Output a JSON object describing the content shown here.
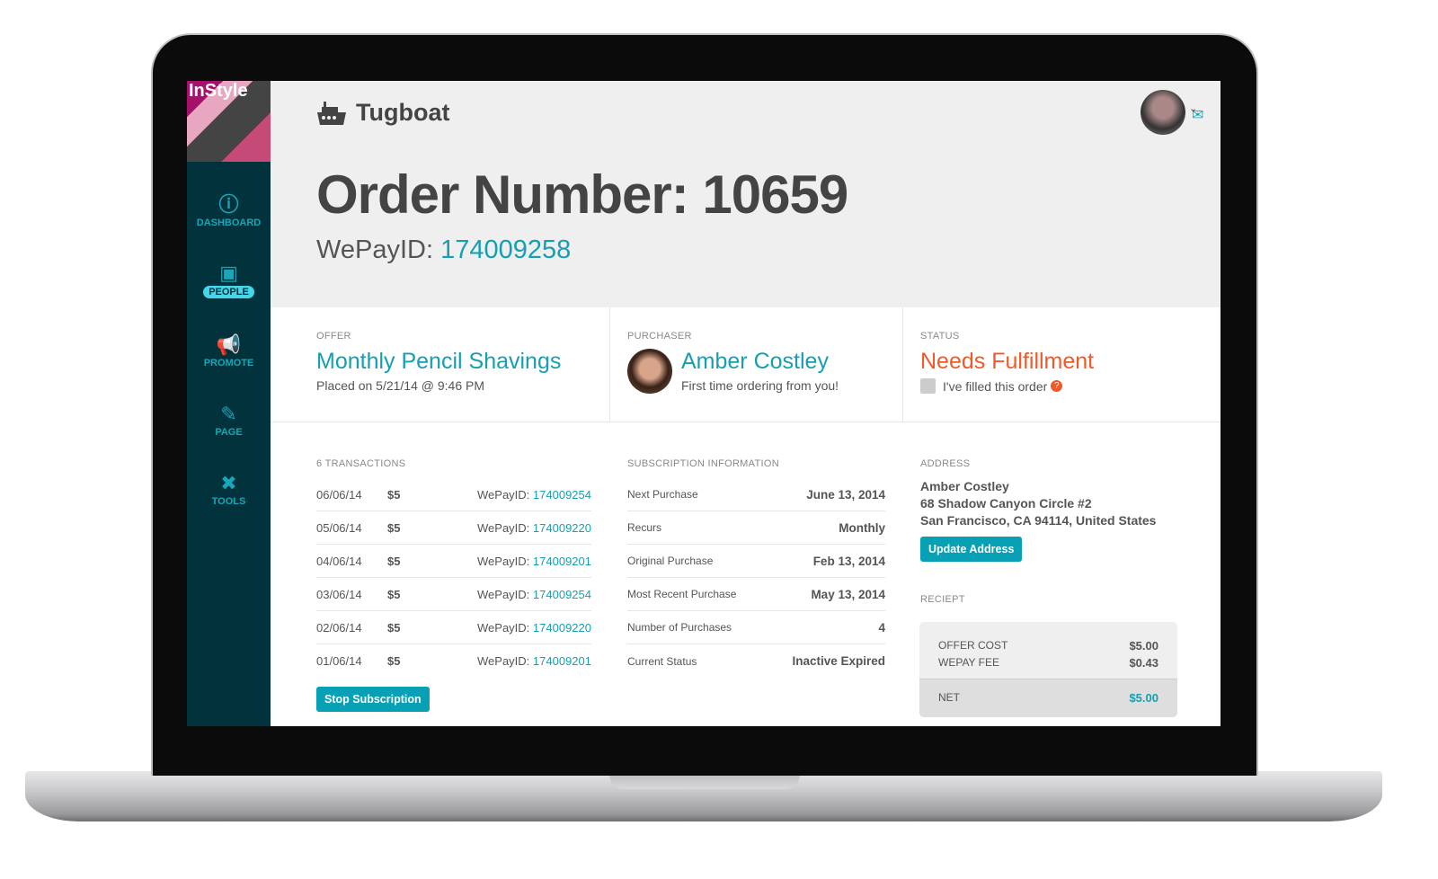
{
  "sidebar": {
    "brand_image_text": "InStyle",
    "items": [
      {
        "label": "DASHBOARD",
        "icon": "gauge-icon"
      },
      {
        "label": "PEOPLE",
        "icon": "address-book-icon",
        "active": true
      },
      {
        "label": "PROMOTE",
        "icon": "megaphone-icon"
      },
      {
        "label": "PAGE",
        "icon": "pencil-icon"
      },
      {
        "label": "TOOLS",
        "icon": "tools-icon"
      }
    ]
  },
  "header": {
    "app_name": "Tugboat",
    "title": "Order Number: 10659",
    "wepay_label": "WePayID:",
    "wepay_id": "174009258"
  },
  "offer": {
    "label": "OFFER",
    "name": "Monthly Pencil Shavings",
    "placed": "Placed on 5/21/14 @ 9:46 PM"
  },
  "purchaser": {
    "label": "PURCHASER",
    "name": "Amber Costley",
    "note": "First time ordering from you!"
  },
  "status": {
    "label": "STATUS",
    "value": "Needs Fulfillment",
    "checkbox_label": "I've filled this order",
    "checked": false,
    "color": "#f05a28"
  },
  "transactions": {
    "label": "6 TRANSACTIONS",
    "rows": [
      {
        "date": "06/06/14",
        "amount": "$5",
        "id_label": "WePayID:",
        "id": "174009254"
      },
      {
        "date": "05/06/14",
        "amount": "$5",
        "id_label": "WePayID:",
        "id": "174009220"
      },
      {
        "date": "04/06/14",
        "amount": "$5",
        "id_label": "WePayID:",
        "id": "174009201"
      },
      {
        "date": "03/06/14",
        "amount": "$5",
        "id_label": "WePayID:",
        "id": "174009254"
      },
      {
        "date": "02/06/14",
        "amount": "$5",
        "id_label": "WePayID:",
        "id": "174009220"
      },
      {
        "date": "01/06/14",
        "amount": "$5",
        "id_label": "WePayID:",
        "id": "174009201"
      }
    ],
    "stop_button": "Stop Subscription"
  },
  "subscription": {
    "label": "SUBSCRIPTION INFORMATION",
    "rows": [
      {
        "key": "Next Purchase",
        "value": "June 13, 2014"
      },
      {
        "key": "Recurs",
        "value": "Monthly"
      },
      {
        "key": "Original Purchase",
        "value": "Feb 13, 2014"
      },
      {
        "key": "Most Recent Purchase",
        "value": "May 13, 2014"
      },
      {
        "key": "Number of Purchases",
        "value": "4"
      },
      {
        "key": "Current Status",
        "value": "Inactive Expired"
      }
    ]
  },
  "address": {
    "label": "ADDRESS",
    "name": "Amber Costley",
    "line1": "68 Shadow Canyon Circle #2",
    "line2": "San Francisco, CA 94114, United States",
    "update_button": "Update Address"
  },
  "receipt": {
    "label": "RECIEPT",
    "offer_cost_label": "OFFER COST",
    "offer_cost": "$5.00",
    "fee_label": "WEPAY FEE",
    "fee": "$0.43",
    "net_label": "NET",
    "net": "$5.00"
  },
  "colors": {
    "accent": "#169fb1",
    "sidebar": "#02323c",
    "status": "#f05a28"
  }
}
